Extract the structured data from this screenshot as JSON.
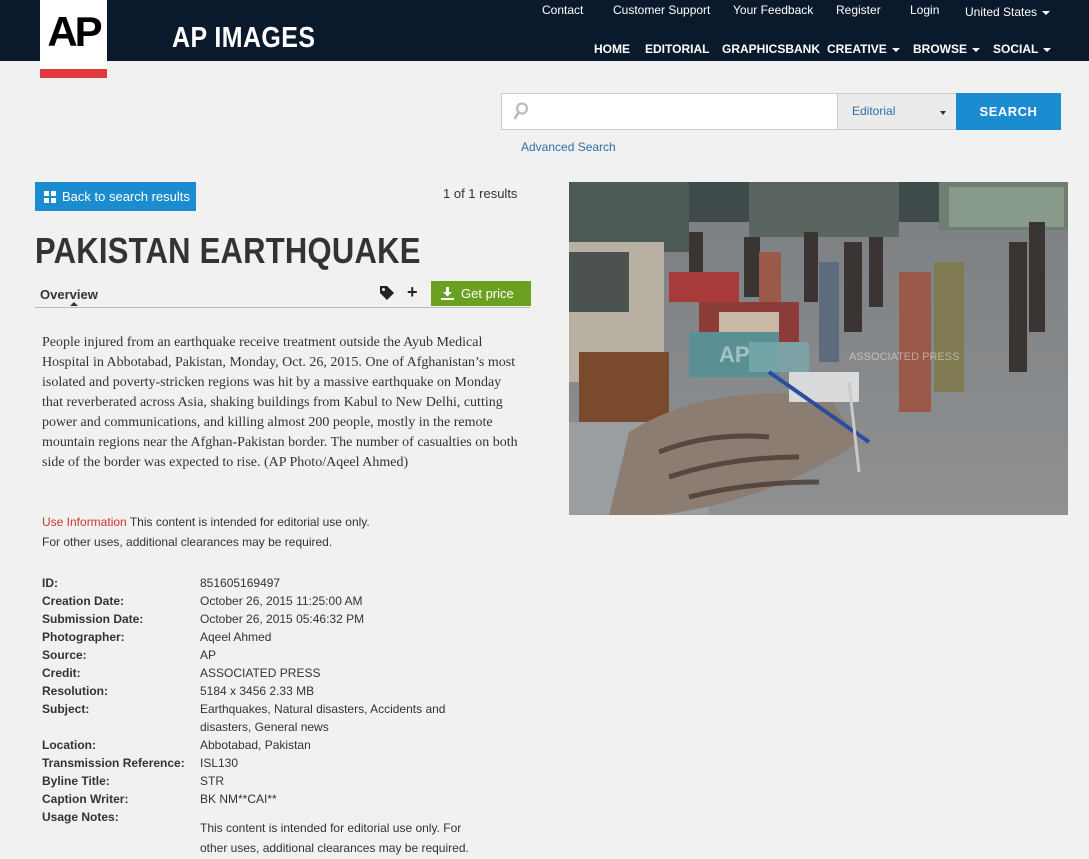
{
  "header": {
    "logo_text": "AP",
    "brand": "AP IMAGES",
    "utility": [
      "Contact",
      "Customer Support",
      "Your Feedback",
      "Register",
      "Login"
    ],
    "country": "United States",
    "nav": [
      "HOME",
      "EDITORIAL",
      "GRAPHICSBANK",
      "CREATIVE",
      "BROWSE",
      "SOCIAL"
    ]
  },
  "search": {
    "value": "",
    "placeholder": "",
    "scope": "Editorial",
    "button": "SEARCH",
    "advanced": "Advanced Search"
  },
  "result": {
    "back_label": "Back to search results",
    "count": "1 of 1 results",
    "title": "PAKISTAN EARTHQUAKE",
    "tab": "Overview",
    "price_label": "Get price",
    "description": "People injured from an earthquake receive treatment outside the Ayub Medical Hospital in Abbotabad, Pakistan, Monday, Oct. 26, 2015. One of Afghanistan’s most isolated and poverty-stricken regions was hit by a massive earthquake on Monday that reverberated across Asia, shaking buildings from Kabul to New Delhi, cutting power and communications, and killing almost 200 people, mostly in the remote mountain regions near the Afghan-Pakistan border. The number of casualties on both side of the border was expected to rise. (AP Photo/Aqeel Ahmed)",
    "use_info_label": "Use Information",
    "use_info_text": "This content is intended for editorial use only.",
    "use_info_text2": "For other uses, additional clearances may be required."
  },
  "metadata": [
    {
      "key": "ID:",
      "value": "851605169497"
    },
    {
      "key": "Creation Date:",
      "value": "October 26, 2015 11:25:00 AM"
    },
    {
      "key": "Submission Date:",
      "value": "October 26, 2015 05:46:32 PM"
    },
    {
      "key": "Photographer:",
      "value": "Aqeel Ahmed"
    },
    {
      "key": "Source:",
      "value": "AP"
    },
    {
      "key": "Credit:",
      "value": "ASSOCIATED PRESS"
    },
    {
      "key": "Resolution:",
      "value": "5184 x 3456 2.33 MB"
    },
    {
      "key": "Subject:",
      "value": "Earthquakes, Natural disasters, Accidents and disasters, General news"
    },
    {
      "key": "Location:",
      "value": "Abbotabad, Pakistan"
    },
    {
      "key": "Transmission Reference:",
      "value": "ISL130"
    },
    {
      "key": "Byline Title:",
      "value": "STR"
    },
    {
      "key": "Caption Writer:",
      "value": "BK NM**CAI**"
    },
    {
      "key": "Usage Notes:",
      "value": ""
    },
    {
      "key": "",
      "value": "This content is intended for editorial use only. For other uses, additional clearances may be required."
    }
  ],
  "photo": {
    "watermark_logo": "AP",
    "watermark_text": "ASSOCIATED PRESS"
  },
  "colors": {
    "header_bg": "#0a1a2c",
    "accent_blue": "#1a8ccf",
    "price_green": "#6aa121",
    "logo_red": "#e03a3e"
  }
}
